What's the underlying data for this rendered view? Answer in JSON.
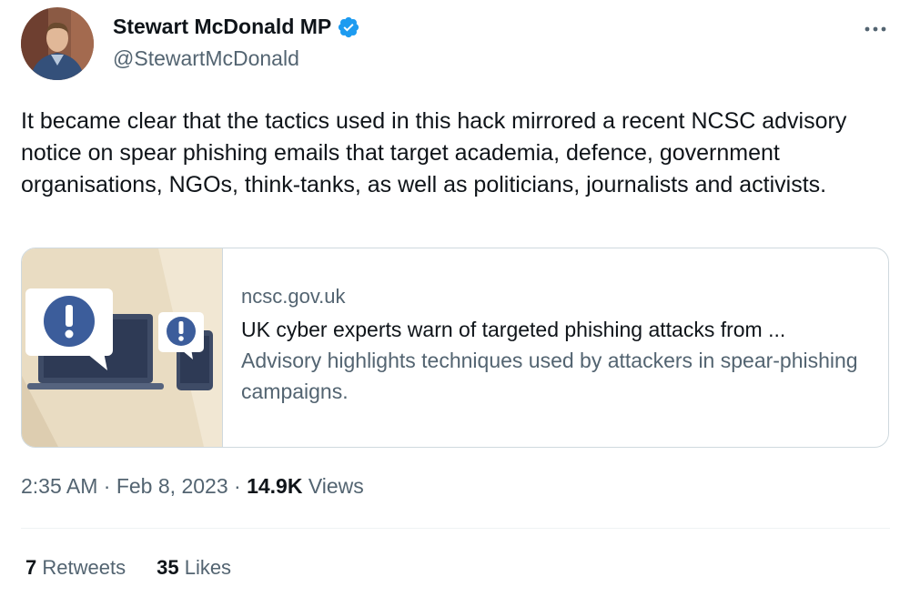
{
  "author": {
    "display_name": "Stewart McDonald MP",
    "handle": "@StewartMcDonald",
    "verified_icon": "verified-badge-icon",
    "avatar_icon": "avatar",
    "brand_color": "#1d9bf0"
  },
  "menu": {
    "icon": "more-icon"
  },
  "tweet": {
    "text": "It became clear that the tactics used in this hack mirrored a recent NCSC advisory notice on spear phishing emails that target academia, defence, government organisations, NGOs, think-tanks, as well as politicians, journalists and activists."
  },
  "card": {
    "domain": "ncsc.gov.uk",
    "title": "UK cyber experts warn of targeted phishing attacks from ...",
    "description": "Advisory highlights techniques used by attackers in spear-phishing campaigns.",
    "image_icon": "phishing-alert-illustration",
    "image_bg": "#e9dcc2",
    "image_accent": "#3c5d9b"
  },
  "meta": {
    "time": "2:35 AM",
    "separator": " · ",
    "date": "Feb 8, 2023",
    "views_count": "14.9K",
    "views_label": "Views"
  },
  "stats": {
    "retweets_count": "7",
    "retweets_label": "Retweets",
    "likes_count": "35",
    "likes_label": "Likes"
  }
}
